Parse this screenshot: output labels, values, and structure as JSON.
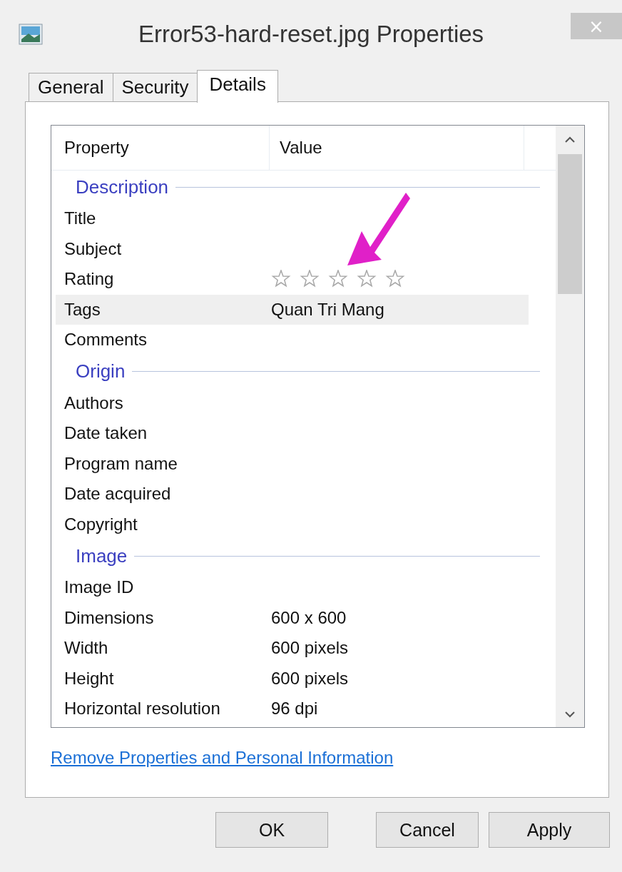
{
  "window": {
    "title": "Error53-hard-reset.jpg Properties",
    "close": "×"
  },
  "tabs": [
    {
      "label": "General",
      "selected": false
    },
    {
      "label": "Security",
      "selected": false
    },
    {
      "label": "Details",
      "selected": true
    }
  ],
  "table": {
    "columns": [
      "Property",
      "Value"
    ],
    "sections": [
      {
        "name": "Description",
        "rows": [
          {
            "kind": "text",
            "property": "Title",
            "selected": false
          },
          {
            "kind": "text",
            "property": "Subject",
            "selected": false
          },
          {
            "kind": "rating",
            "property": "Rating",
            "stars": 0,
            "selected": false
          },
          {
            "kind": "text",
            "property": "Tags",
            "value": "Quan Tri Mang",
            "selected": true
          },
          {
            "kind": "text",
            "property": "Comments",
            "selected": false
          }
        ]
      },
      {
        "name": "Origin",
        "rows": [
          {
            "kind": "text",
            "property": "Authors",
            "selected": false
          },
          {
            "kind": "text",
            "property": "Date taken",
            "selected": false
          },
          {
            "kind": "text",
            "property": "Program name",
            "selected": false
          },
          {
            "kind": "text",
            "property": "Date acquired",
            "selected": false
          },
          {
            "kind": "text",
            "property": "Copyright",
            "selected": false
          }
        ]
      },
      {
        "name": "Image",
        "rows": [
          {
            "kind": "text",
            "property": "Image ID",
            "selected": false
          },
          {
            "kind": "text",
            "property": "Dimensions",
            "value": "600 x 600",
            "selected": false
          },
          {
            "kind": "text",
            "property": "Width",
            "value": "600 pixels",
            "selected": false
          },
          {
            "kind": "text",
            "property": "Height",
            "value": "600 pixels",
            "selected": false
          },
          {
            "kind": "text",
            "property": "Horizontal resolution",
            "value": "96 dpi",
            "selected": false
          }
        ]
      }
    ]
  },
  "link": "Remove Properties and Personal Information",
  "buttons": [
    "OK",
    "Cancel",
    "Apply"
  ]
}
